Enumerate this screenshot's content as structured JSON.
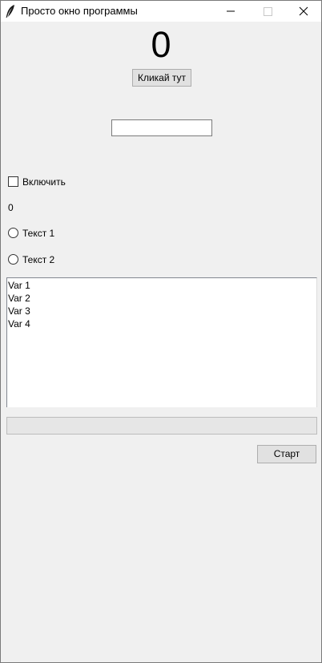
{
  "window": {
    "title": "Просто окно программы",
    "icon": "feather-icon"
  },
  "titlebar_buttons": [
    "minimize-icon",
    "maximize-icon",
    "close-icon"
  ],
  "counter": {
    "value": "0"
  },
  "buttons": {
    "click_label": "Кликай тут",
    "start_label": "Старт"
  },
  "entry": {
    "value": ""
  },
  "checkbox": {
    "label": "Включить",
    "checked": false
  },
  "value_label": "0",
  "radios": [
    {
      "label": "Текст 1",
      "selected": false
    },
    {
      "label": "Текст 2",
      "selected": false
    }
  ],
  "listbox": {
    "items": [
      "Var 1",
      "Var 2",
      "Var 3",
      "Var 4"
    ]
  },
  "progress": {
    "value": 0
  }
}
